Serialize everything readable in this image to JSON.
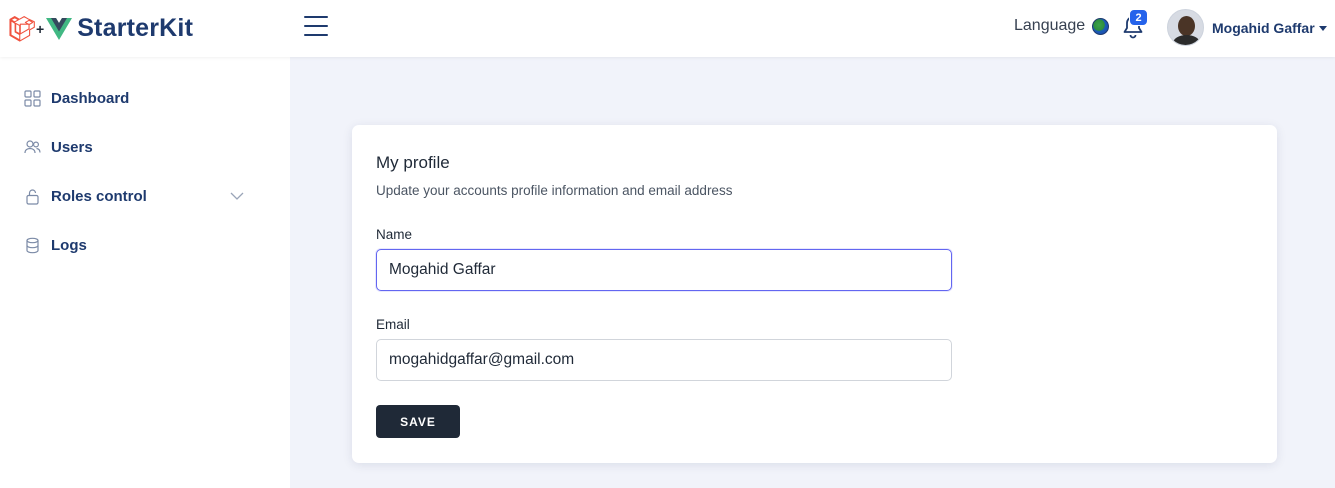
{
  "brand": {
    "name": "StarterKit",
    "plus": "+",
    "laravel_color": "#f05340",
    "vue_color": "#41b883",
    "vue_dark": "#35495e"
  },
  "topbar": {
    "language_label": "Language",
    "notifications_count": "2",
    "user_name": "Mogahid Gaffar"
  },
  "sidebar": {
    "items": [
      {
        "label": "Dashboard",
        "icon": "grid-icon"
      },
      {
        "label": "Users",
        "icon": "users-icon"
      },
      {
        "label": "Roles control",
        "icon": "lock-icon"
      },
      {
        "label": "Logs",
        "icon": "database-icon"
      }
    ]
  },
  "profile": {
    "title": "My profile",
    "subtitle": "Update your accounts profile information and email address",
    "name_label": "Name",
    "name_value": "Mogahid Gaffar",
    "email_label": "Email",
    "email_value": "mogahidgaffar@gmail.com",
    "save_label": "SAVE"
  },
  "colors": {
    "accent": "#1e3a6e",
    "background": "#f1f3fa",
    "badge": "#2563eb",
    "focus": "#6366f1",
    "button": "#1f2937"
  }
}
